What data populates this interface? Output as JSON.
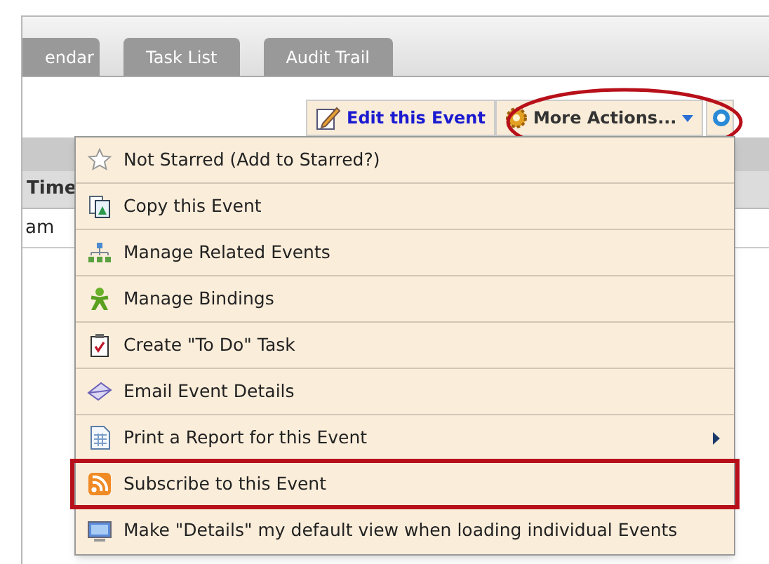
{
  "tabs": [
    {
      "label": "endar",
      "selected": false
    },
    {
      "label": "Task List",
      "selected": false
    },
    {
      "label": "Audit Trail",
      "selected": false
    }
  ],
  "toolbar": {
    "edit_button": "Edit this Event",
    "more_actions": {
      "label": "More Actions...",
      "circled": true
    }
  },
  "table": {
    "columns": [
      "Time"
    ],
    "rows": [
      [
        "am"
      ]
    ]
  },
  "menu": {
    "items": [
      {
        "kind": "star",
        "label": "Not Starred (Add to Starred?)",
        "submenu": false,
        "boxed": false
      },
      {
        "kind": "copy",
        "label": "Copy this Event",
        "submenu": false,
        "boxed": false
      },
      {
        "kind": "hierarchy",
        "label": "Manage Related Events",
        "submenu": false,
        "boxed": false
      },
      {
        "kind": "person",
        "label": "Manage Bindings",
        "submenu": false,
        "boxed": false
      },
      {
        "kind": "clipboard",
        "label": "Create \"To Do\" Task",
        "submenu": false,
        "boxed": false
      },
      {
        "kind": "envelope",
        "label": "Email Event Details",
        "submenu": false,
        "boxed": false
      },
      {
        "kind": "document",
        "label": "Print a Report for this Event",
        "submenu": true,
        "boxed": false
      },
      {
        "kind": "rss",
        "label": "Subscribe to this Event",
        "submenu": false,
        "boxed": true
      },
      {
        "kind": "monitor",
        "label": "Make \"Details\" my default view when loading individual Events",
        "submenu": false,
        "boxed": false
      }
    ]
  }
}
